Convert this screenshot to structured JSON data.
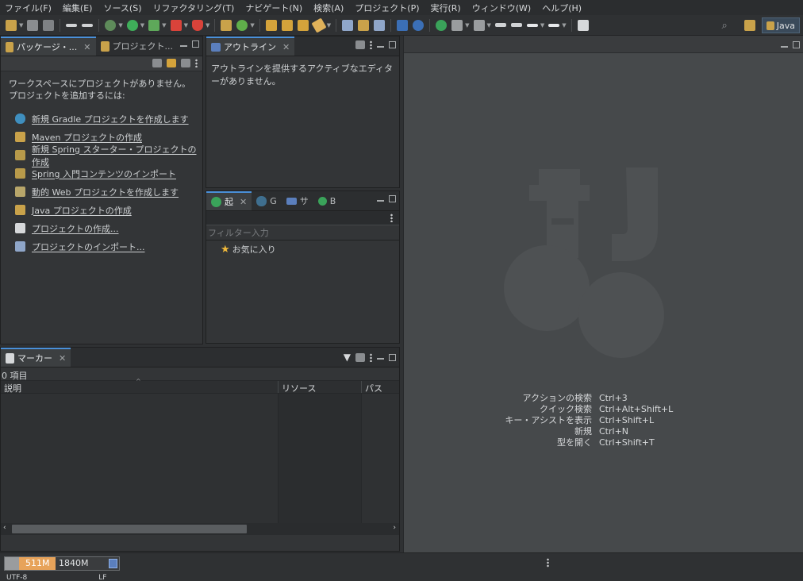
{
  "menubar": {
    "items": [
      "ファイル(F)",
      "編集(E)",
      "ソース(S)",
      "リファクタリング(T)",
      "ナビゲート(N)",
      "検索(A)",
      "プロジェクト(P)",
      "実行(R)",
      "ウィンドウ(W)",
      "ヘルプ(H)"
    ]
  },
  "toolbar": {
    "perspective_label": "Java"
  },
  "package_explorer": {
    "tabs": [
      "パッケージ・...",
      "プロジェクト..."
    ],
    "empty_text_1": "ワークスペースにプロジェクトがありません。",
    "empty_text_2": "プロジェクトを追加するには:",
    "links": [
      "新規 Gradle プロジェクトを作成します",
      "Maven プロジェクトの作成",
      "新規 Spring スターター・プロジェクトの作成",
      "Spring 入門コンテンツのインポート",
      "動的 Web プロジェクトを作成します",
      "Java プロジェクトの作成",
      "プロジェクトの作成...",
      "プロジェクトのインポート..."
    ]
  },
  "outline": {
    "tab_label": "アウトライン",
    "message": "アウトラインを提供するアクティブなエディターがありません。"
  },
  "boot_dashboard": {
    "tabs": [
      "起",
      "G",
      "サ",
      "B"
    ],
    "filter_placeholder": "フィルター入力",
    "favorites_label": "お気に入り"
  },
  "markers": {
    "tab_label": "マーカー",
    "count_text": "0 項目",
    "columns": [
      "説明",
      "リソース",
      "パス"
    ]
  },
  "editor": {
    "shortcuts": [
      {
        "name": "アクションの検索",
        "key": "Ctrl+3"
      },
      {
        "name": "クイック検索",
        "key": "Ctrl+Alt+Shift+L"
      },
      {
        "name": "キー・アシストを表示",
        "key": "Ctrl+Shift+L"
      },
      {
        "name": "新規",
        "key": "Ctrl+N"
      },
      {
        "name": "型を開く",
        "key": "Ctrl+Shift+T"
      }
    ]
  },
  "statusbar": {
    "heap_used": "511M",
    "heap_total": "1840M",
    "encoding": "UTF-8",
    "line_ending": "LF"
  },
  "colors": {
    "accent": "#4a90d9",
    "heap_used": "#e7a35a"
  }
}
